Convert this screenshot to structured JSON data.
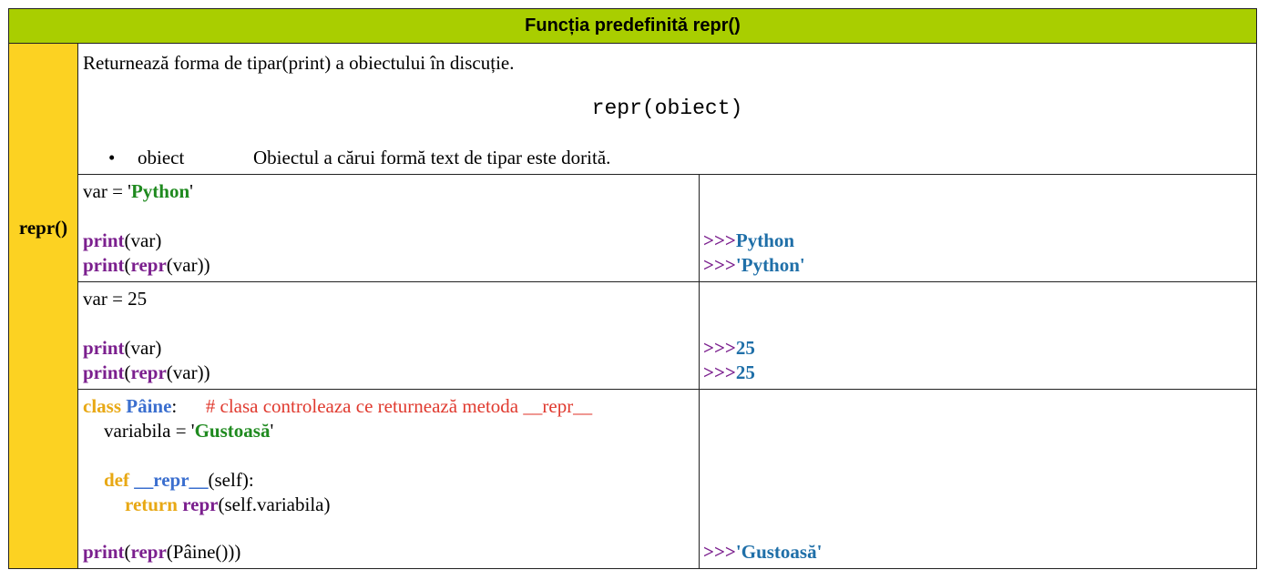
{
  "title": "Funcția predefinită repr()",
  "side_label": "repr()",
  "description": "Returnează forma de tipar(print) a obiectului în discuție.",
  "syntax": "repr(obiect)",
  "param": {
    "bullet": "•",
    "name": "obiect",
    "desc": "Obiectul a cărui formă text de tipar este dorită."
  },
  "ex1": {
    "var_prefix": "var = '",
    "var_value": "Python",
    "var_suffix": "'",
    "print_kw": "print",
    "repr_kw": "repr",
    "paren_var": "(var)",
    "open": "(",
    "close": ")",
    "out_prompt": ">>>",
    "out1": "Python",
    "out2": "'Python'"
  },
  "ex2": {
    "var_line": "var = 25",
    "print_kw": "print",
    "repr_kw": "repr",
    "paren_var": "(var)",
    "open": "(",
    "close": ")",
    "out_prompt": ">>>",
    "out1": "25",
    "out2": "25"
  },
  "ex3": {
    "class_kw": "class",
    "class_name": "Pâine",
    "colon": ":",
    "comment": "# clasa controleaza ce returnează metoda __repr__",
    "attr_prefix": "variabila = '",
    "attr_value": "Gustoasă",
    "attr_suffix": "'",
    "def_kw": "def",
    "method_name": "__repr__",
    "method_args": "(self):",
    "return_kw": "return",
    "repr_kw": "repr",
    "return_args": "(self.variabila)",
    "print_kw": "print",
    "call_args": "(Pâine()))",
    "open": "(",
    "out_prompt": ">>>",
    "out": "'Gustoasă'"
  }
}
